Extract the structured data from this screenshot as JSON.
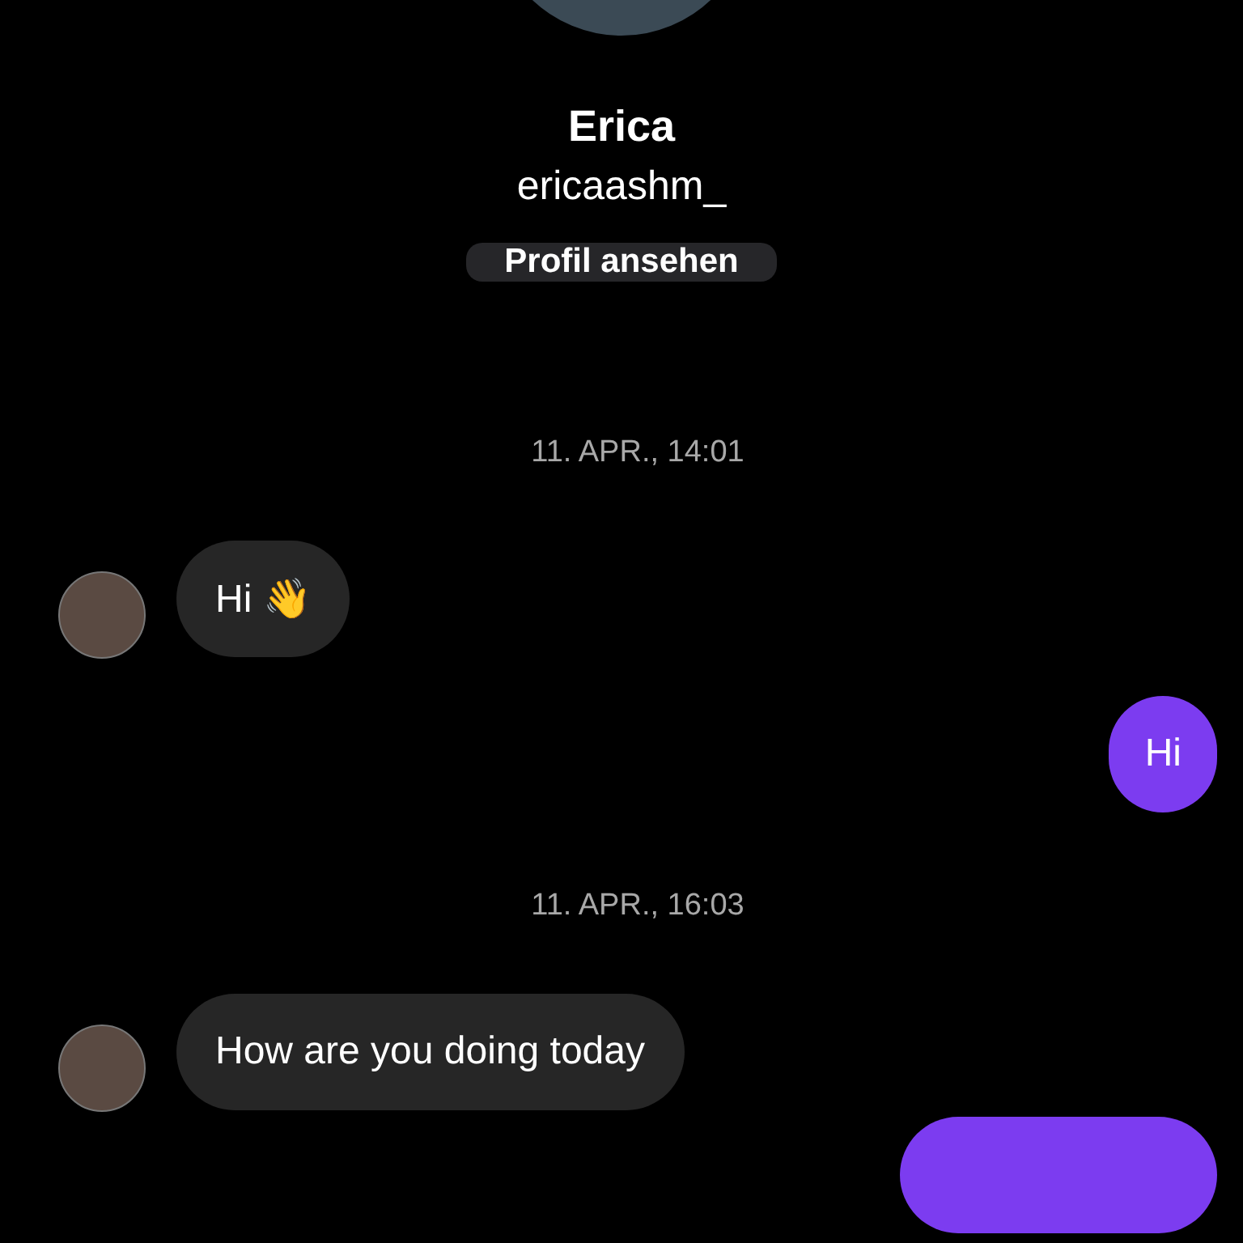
{
  "profile": {
    "name": "Erica",
    "username": "ericaashm_",
    "button": "Profil ansehen"
  },
  "thread": [
    {
      "kind": "timestamp",
      "text": "11. APR., 14:01"
    },
    {
      "kind": "incoming",
      "text": "Hi 👋"
    },
    {
      "kind": "outgoing",
      "text": "Hi"
    },
    {
      "kind": "timestamp",
      "text": "11. APR., 16:03"
    },
    {
      "kind": "incoming",
      "text": "How are you doing today"
    },
    {
      "kind": "outgoing_cut"
    }
  ]
}
